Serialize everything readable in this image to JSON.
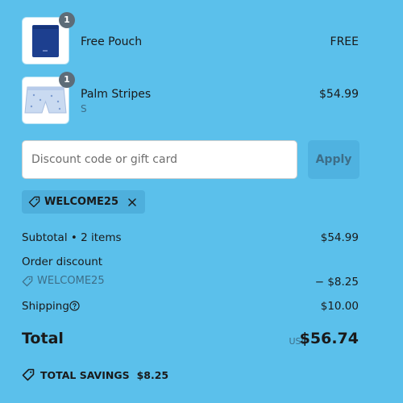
{
  "items": [
    {
      "name": "Free Pouch",
      "variant": "",
      "price": "FREE",
      "quantity": "1",
      "image": "navy-pouch"
    },
    {
      "name": "Palm Stripes",
      "variant": "S",
      "price": "$54.99",
      "quantity": "1",
      "image": "light-blue-shorts"
    }
  ],
  "discount": {
    "placeholder": "Discount code or gift card",
    "value": "",
    "apply_label": "Apply",
    "applied_code": "WELCOME25"
  },
  "summary": {
    "subtotal_label": "Subtotal • 2 items",
    "subtotal_value": "$54.99",
    "order_discount_label": "Order discount",
    "discount_code": "WELCOME25",
    "discount_value": "− $8.25",
    "shipping_label": "Shipping",
    "shipping_value": "$10.00",
    "total_label": "Total",
    "currency": "USD",
    "total_value": "$56.74",
    "savings_label": "TOTAL SAVINGS",
    "savings_value": "$8.25"
  },
  "colors": {
    "background": "#5bc0eb",
    "badge": "#5d6c78",
    "muted_text": "#3d6e88"
  },
  "icons": [
    "tag-icon",
    "close-icon",
    "help-circle-icon"
  ]
}
